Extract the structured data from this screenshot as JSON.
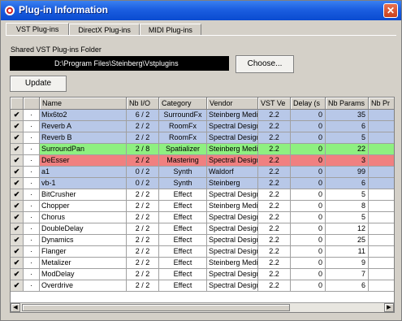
{
  "window": {
    "title": "Plug-in Information",
    "close_glyph": "✕"
  },
  "tabs": [
    {
      "label": "VST Plug-ins",
      "active": true
    },
    {
      "label": "DirectX Plug-ins",
      "active": false
    },
    {
      "label": "MIDI Plug-ins",
      "active": false
    }
  ],
  "folder": {
    "label": "Shared VST Plug-ins Folder",
    "path": "D:\\Program Files\\Steinberg\\Vstplugins",
    "choose_label": "Choose..."
  },
  "update_label": "Update",
  "columns": [
    "",
    "",
    "Name",
    "Nb I/O",
    "Category",
    "Vendor",
    "VST Ve",
    "Delay (s",
    "Nb Params",
    "Nb Pr"
  ],
  "rows": [
    {
      "checked": true,
      "mark": "·",
      "name": "Mix6to2",
      "io": "6 / 2",
      "category": "SurroundFx",
      "vendor": "Steinberg Media",
      "vst": "2.2",
      "delay": "0",
      "params": "35",
      "progs": "",
      "color": "#b8c8e8"
    },
    {
      "checked": true,
      "mark": "·",
      "name": "Reverb A",
      "io": "2 / 2",
      "category": "RoomFx",
      "vendor": "Spectral Design",
      "vst": "2.2",
      "delay": "0",
      "params": "6",
      "progs": "",
      "color": "#b8c8e8"
    },
    {
      "checked": true,
      "mark": "·",
      "name": "Reverb B",
      "io": "2 / 2",
      "category": "RoomFx",
      "vendor": "Spectral Design",
      "vst": "2.2",
      "delay": "0",
      "params": "5",
      "progs": "",
      "color": "#b8c8e8"
    },
    {
      "checked": true,
      "mark": "·",
      "name": "SurroundPan",
      "io": "2 / 8",
      "category": "Spatializer",
      "vendor": "Steinberg Media",
      "vst": "2.2",
      "delay": "0",
      "params": "22",
      "progs": "",
      "color": "#8ef080"
    },
    {
      "checked": true,
      "mark": "·",
      "name": "DeEsser",
      "io": "2 / 2",
      "category": "Mastering",
      "vendor": "Spectral Design",
      "vst": "2.2",
      "delay": "0",
      "params": "3",
      "progs": "",
      "color": "#f08080"
    },
    {
      "checked": true,
      "mark": "·",
      "name": "a1",
      "io": "0 / 2",
      "category": "Synth",
      "vendor": "Waldorf",
      "vst": "2.2",
      "delay": "0",
      "params": "99",
      "progs": "",
      "color": "#b8c8e8"
    },
    {
      "checked": true,
      "mark": "·",
      "name": "vb-1",
      "io": "0 / 2",
      "category": "Synth",
      "vendor": "Steinberg",
      "vst": "2.2",
      "delay": "0",
      "params": "6",
      "progs": "",
      "color": "#b8c8e8"
    },
    {
      "checked": true,
      "mark": "·",
      "name": "BitCrusher",
      "io": "2 / 2",
      "category": "Effect",
      "vendor": "Spectral Design",
      "vst": "2.2",
      "delay": "0",
      "params": "5",
      "progs": "",
      "color": "#ffffff"
    },
    {
      "checked": true,
      "mark": "·",
      "name": "Chopper",
      "io": "2 / 2",
      "category": "Effect",
      "vendor": "Steinberg Media",
      "vst": "2.2",
      "delay": "0",
      "params": "8",
      "progs": "",
      "color": "#ffffff"
    },
    {
      "checked": true,
      "mark": "·",
      "name": "Chorus",
      "io": "2 / 2",
      "category": "Effect",
      "vendor": "Spectral Design",
      "vst": "2.2",
      "delay": "0",
      "params": "5",
      "progs": "",
      "color": "#ffffff"
    },
    {
      "checked": true,
      "mark": "·",
      "name": "DoubleDelay",
      "io": "2 / 2",
      "category": "Effect",
      "vendor": "Spectral Design",
      "vst": "2.2",
      "delay": "0",
      "params": "12",
      "progs": "",
      "color": "#ffffff"
    },
    {
      "checked": true,
      "mark": "·",
      "name": "Dynamics",
      "io": "2 / 2",
      "category": "Effect",
      "vendor": "Spectral Design",
      "vst": "2.2",
      "delay": "0",
      "params": "25",
      "progs": "",
      "color": "#ffffff"
    },
    {
      "checked": true,
      "mark": "·",
      "name": "Flanger",
      "io": "2 / 2",
      "category": "Effect",
      "vendor": "Spectral Design",
      "vst": "2.2",
      "delay": "0",
      "params": "11",
      "progs": "",
      "color": "#ffffff"
    },
    {
      "checked": true,
      "mark": "·",
      "name": "Metalizer",
      "io": "2 / 2",
      "category": "Effect",
      "vendor": "Steinberg Media",
      "vst": "2.2",
      "delay": "0",
      "params": "9",
      "progs": "",
      "color": "#ffffff"
    },
    {
      "checked": true,
      "mark": "·",
      "name": "ModDelay",
      "io": "2 / 2",
      "category": "Effect",
      "vendor": "Spectral Design",
      "vst": "2.2",
      "delay": "0",
      "params": "7",
      "progs": "",
      "color": "#ffffff"
    },
    {
      "checked": true,
      "mark": "·",
      "name": "Overdrive",
      "io": "2 / 2",
      "category": "Effect",
      "vendor": "Spectral Design",
      "vst": "2.2",
      "delay": "0",
      "params": "6",
      "progs": "",
      "color": "#ffffff"
    }
  ],
  "icons": {
    "checkbox": "checkmark-icon",
    "scroll_left": "arrow-left-icon",
    "scroll_right": "arrow-right-icon"
  }
}
